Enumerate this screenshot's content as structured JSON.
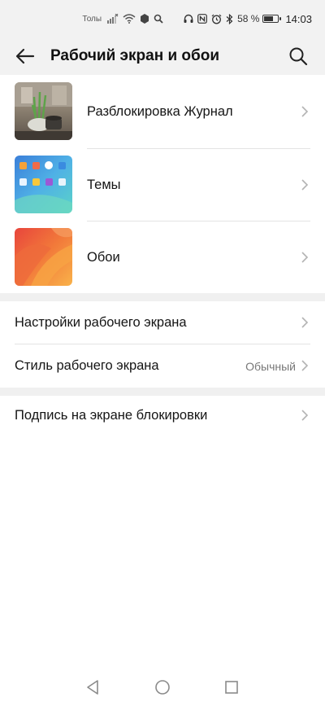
{
  "status_bar": {
    "carrier": "Толы",
    "battery": "58 %",
    "battery_level": 0.58,
    "time": "14:03"
  },
  "header": {
    "title": "Рабочий экран и обои"
  },
  "content_items": [
    {
      "label": "Разблокировка Журнал"
    },
    {
      "label": "Темы"
    },
    {
      "label": "Обои"
    }
  ],
  "settings": {
    "home_settings": "Настройки рабочего экрана",
    "home_style": "Стиль рабочего экрана",
    "home_style_value": "Обычный",
    "lock_signature": "Подпись на экране блокировки"
  },
  "colors": {
    "background": "#ffffff",
    "bar_background": "#f2f2f2",
    "text_primary": "#151515",
    "text_secondary": "#777777"
  }
}
